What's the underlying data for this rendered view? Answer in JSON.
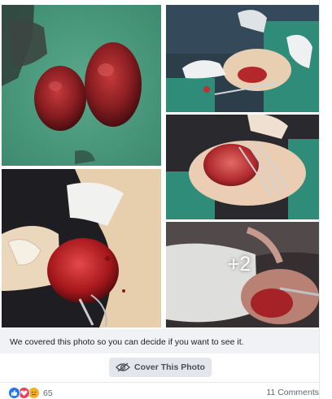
{
  "photos": {
    "items": [
      {
        "id": "photo-1",
        "subject": "excised-tissue"
      },
      {
        "id": "photo-2",
        "subject": "surgery-gloved-hands"
      },
      {
        "id": "photo-3",
        "subject": "surgical-field-retractors"
      },
      {
        "id": "photo-4",
        "subject": "surgical-field-mass"
      },
      {
        "id": "photo-5",
        "subject": "surgical-field-closeup"
      }
    ],
    "more_count_label": "+2"
  },
  "sensitive_notice": {
    "text": "We covered this photo so you can decide if you want to see it.",
    "button_label": "Cover This Photo",
    "button_icon": "eye-slash-icon"
  },
  "footer": {
    "reactions": [
      "like",
      "love",
      "sad"
    ],
    "reaction_count": "65",
    "comments_label": "11 Comments"
  },
  "colors": {
    "like": "#1877f2",
    "love": "#f33e58",
    "sad": "#f7b125",
    "notice_bg": "#f0f2f5",
    "button_bg": "#e4e6eb",
    "secondary_text": "#606770"
  }
}
